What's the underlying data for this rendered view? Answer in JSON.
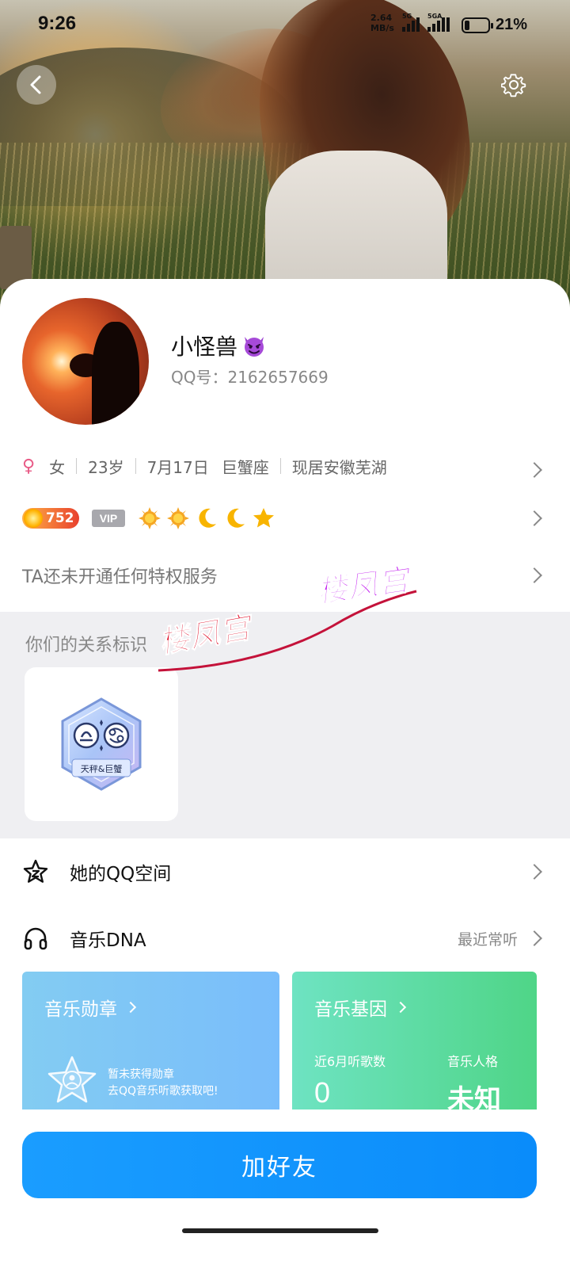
{
  "status_bar": {
    "time": "9:26",
    "net_speed_value": "2.64",
    "net_speed_unit": "MB/s",
    "sim1_label": "5G",
    "sim2_label": "5GA",
    "battery_percent_text": "21%",
    "battery_level": 0.21
  },
  "header": {
    "back_icon": "chevron-left-icon",
    "settings_icon": "gear-icon"
  },
  "profile": {
    "nickname": "小怪兽",
    "nickname_emoji": "devil-face-icon",
    "qq_number": "QQ号：2162657669"
  },
  "info": {
    "gender_icon": "female-icon",
    "gender": "女",
    "age": "23岁",
    "birthday": "7月17日",
    "zodiac": "巨蟹座",
    "location": "现居安徽芜湖"
  },
  "level": {
    "badge_value": "752",
    "vip_label": "VIP",
    "icons": [
      "sun-icon",
      "sun-icon",
      "moon-icon",
      "moon-icon",
      "star-icon"
    ]
  },
  "privilege": {
    "text": "TA还未开通任何特权服务"
  },
  "relationship": {
    "title": "你们的关系标识",
    "badge_label": "天秤&巨蟹"
  },
  "watermark": {
    "text1": "楼凤宫",
    "text2": "楼凤宫"
  },
  "list": {
    "qzone_label": "她的QQ空间",
    "music_dna_label": "音乐DNA",
    "music_dna_trailing": "最近常听"
  },
  "music_medal": {
    "title": "音乐勋章",
    "line1": "暂未获得勋章",
    "line2": "去QQ音乐听歌获取吧!"
  },
  "music_gene": {
    "title": "音乐基因",
    "songs_label": "近6月听歌数",
    "songs_value": "0",
    "persona_label": "音乐人格",
    "persona_value": "未知"
  },
  "action": {
    "add_friend": "加好友"
  },
  "colors": {
    "primary_button": "#0a8cfa",
    "female": "#e85a86",
    "medal_card": "#79bdfb",
    "gene_card": "#4fd587"
  }
}
